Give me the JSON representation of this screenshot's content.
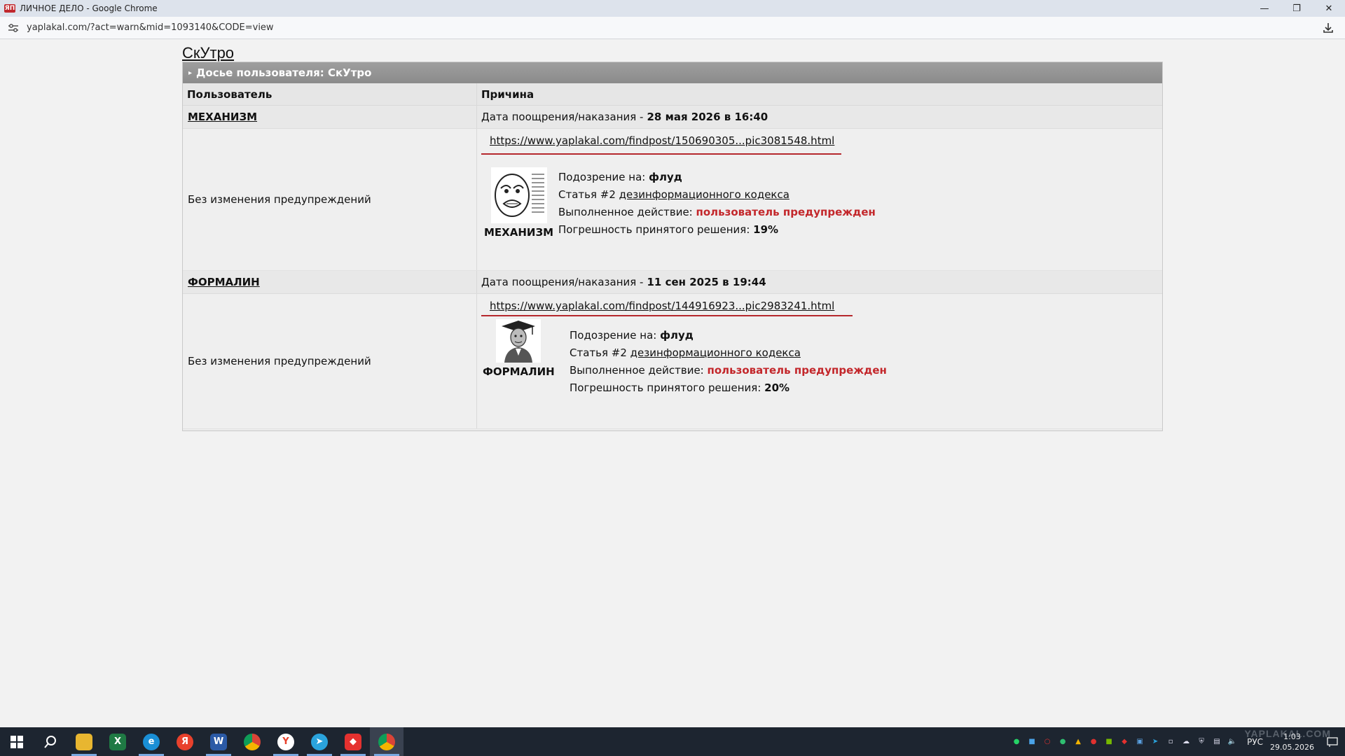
{
  "window": {
    "title": "ЛИЧНОЕ ДЕЛО - Google Chrome",
    "favicon_text": "ЯП"
  },
  "address_bar": {
    "url": "yaplakal.com/?act=warn&mid=1093140&CODE=view"
  },
  "page": {
    "user_heading": "СкУтро",
    "panel_title": "Досье пользователя: СкУтро",
    "columns": {
      "user": "Пользователь",
      "reason": "Причина"
    },
    "records": [
      {
        "moderator": "МЕХАНИЗМ",
        "date_label": "Дата поощрения/наказания -",
        "date_value": "28 мая 2026 в 16:40",
        "change_text": "Без изменения предупреждений",
        "post_link": "https://www.yaplakal.com/findpost/150690305...pic3081548.html",
        "avatar_name": "МЕХАНИЗМ",
        "suspicion_label": "Подозрение на:",
        "suspicion_value": "флуд",
        "article_prefix": "Статья #2",
        "article_link": "дезинформационного кодекса",
        "action_label": "Выполненное действие:",
        "action_value": "пользователь предупрежден",
        "error_label": "Погрешность принятого решения:",
        "error_value": "19%"
      },
      {
        "moderator": "ФОРМАЛИН",
        "date_label": "Дата поощрения/наказания -",
        "date_value": "11 сен 2025 в 19:44",
        "change_text": "Без изменения предупреждений",
        "post_link": "https://www.yaplakal.com/findpost/144916923...pic2983241.html",
        "avatar_name": "ФОРМАЛИН",
        "suspicion_label": "Подозрение на:",
        "suspicion_value": "флуд",
        "article_prefix": "Статья #2",
        "article_link": "дезинформационного кодекса",
        "action_label": "Выполненное действие:",
        "action_value": "пользователь предупрежден",
        "error_label": "Погрешность принятого решения:",
        "error_value": "20%"
      }
    ]
  },
  "taskbar": {
    "apps": [
      "start",
      "search",
      "file-explorer",
      "excel",
      "edge",
      "yandex",
      "word",
      "chrome",
      "yandex-browser",
      "telegram",
      "anydesk",
      "chrome-active"
    ],
    "language": "РУС",
    "time": "1:03",
    "date": "29.05.2026"
  },
  "watermark": "YAPLAKAL.COM",
  "colors": {
    "accent_red": "#c3272b",
    "panel_header": "#909090",
    "taskbar": "#1d2530"
  }
}
